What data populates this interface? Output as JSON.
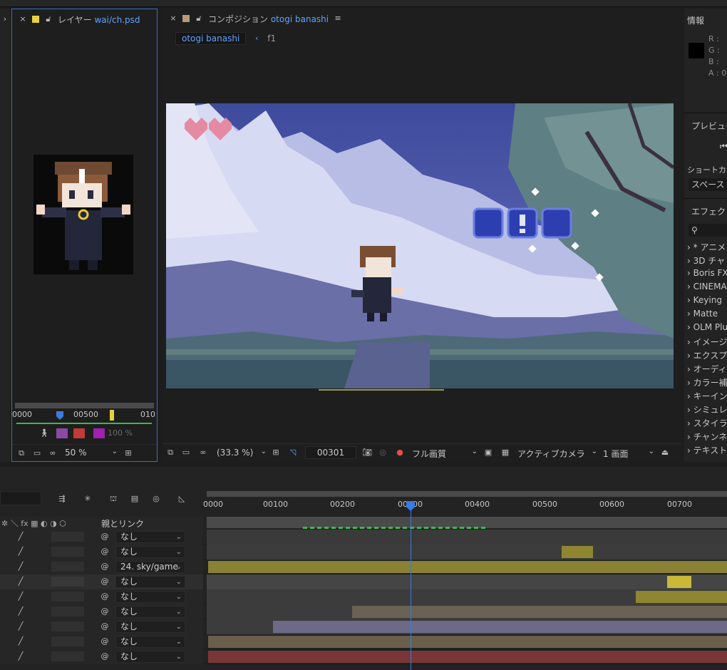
{
  "layer_panel": {
    "tab_label": "レイヤー",
    "tab_file": "wai/ch.psd",
    "ruler": [
      "0000",
      "00500",
      "010"
    ],
    "opacity": "100 %",
    "zoom": "50 %"
  },
  "comp_panel": {
    "tab_label": "コンポジション",
    "tab_name": "otogi banashi",
    "breadcrumb_current": "otogi banashi",
    "breadcrumb_next": "f1",
    "zoom": "(33.3 %)",
    "timecode": "00301",
    "quality": "フル画質",
    "camera": "アクティブカメラ",
    "views": "1 画面"
  },
  "right_panel": {
    "info_title": "情報",
    "rgba": [
      "R :",
      "G :",
      "B :",
      "A : 0"
    ],
    "preview_title": "プレビュー",
    "shortcut_label": "ショートカ",
    "shortcut_value": "スペース",
    "effects_title": "エフェクト",
    "effects": [
      "* アニメ",
      "3D チャ",
      "Boris FX",
      "CINEMA",
      "Keying",
      "Matte",
      "OLM Plu",
      "イメージ",
      "エクスプ",
      "オーディ",
      "カラー補",
      "キーイン",
      "シミュレ",
      "スタイラ",
      "チャンネ",
      "テキスト"
    ]
  },
  "timeline": {
    "parent_header": "親とリンク",
    "ruler": [
      "0000",
      "00100",
      "00200",
      "00300",
      "00400",
      "00500",
      "00600",
      "00700"
    ],
    "rows": [
      {
        "parent": "なし"
      },
      {
        "parent": "なし"
      },
      {
        "parent": "24. sky/game"
      },
      {
        "parent": "なし"
      },
      {
        "parent": "なし"
      },
      {
        "parent": "なし"
      },
      {
        "parent": "なし"
      },
      {
        "parent": "なし"
      },
      {
        "parent": "なし"
      }
    ]
  },
  "colors": {
    "accent_blue": "#3a6fc4",
    "bar_olive": "#8f8632",
    "bar_yellow": "#b9a93a",
    "bar_tan": "#6b6154",
    "bar_lavender": "#6c6a87",
    "bar_brown": "#6a5e4c",
    "bar_red": "#7a3636"
  }
}
